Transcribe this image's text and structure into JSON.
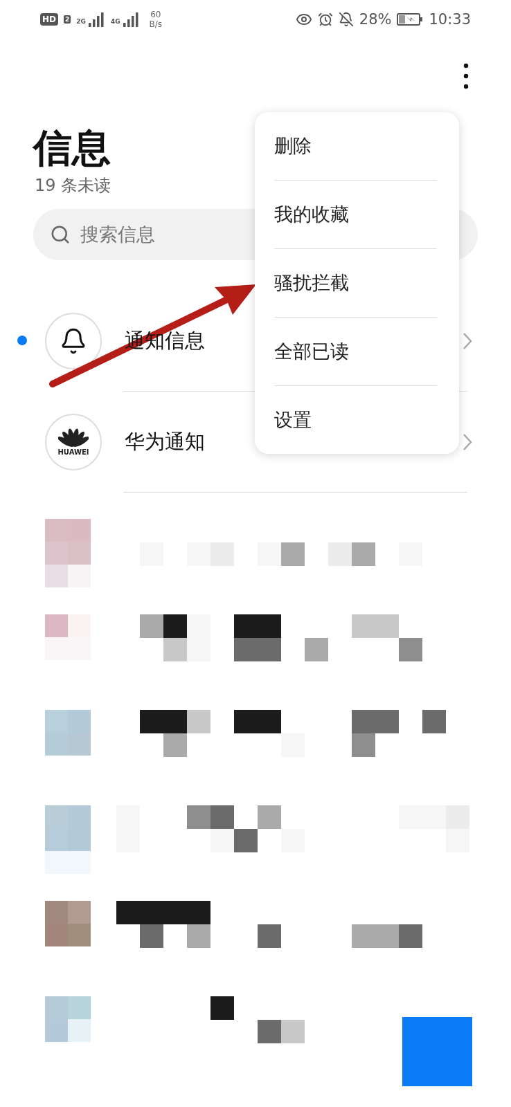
{
  "status_bar": {
    "hd": "HD",
    "sim": "2",
    "network_1": "2G",
    "network_2": "4G",
    "speed": "60",
    "speed_unit": "B/s",
    "battery": "28%",
    "time": "10:33"
  },
  "header": {
    "title": "信息",
    "subtitle": "19 条未读"
  },
  "search": {
    "placeholder": "搜索信息"
  },
  "menu": [
    {
      "label": "删除"
    },
    {
      "label": "我的收藏"
    },
    {
      "label": "骚扰拦截"
    },
    {
      "label": "全部已读"
    },
    {
      "label": "设置"
    }
  ],
  "conversations": [
    {
      "name": "通知信息",
      "unread": true,
      "avatar": {
        "kind": "bell"
      }
    },
    {
      "name": "华为通知",
      "unread": false,
      "avatar": {
        "kind": "logo",
        "text": "HUAWEI"
      }
    }
  ]
}
